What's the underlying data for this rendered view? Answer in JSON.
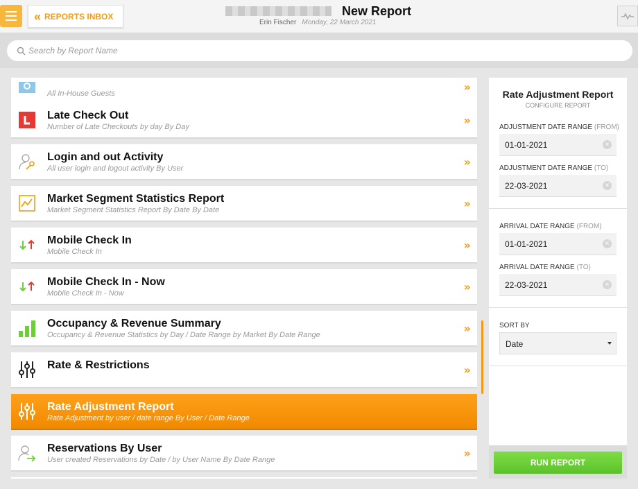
{
  "header": {
    "back_label": "REPORTS INBOX",
    "title": "New Report",
    "user": "Erin Fischer",
    "date": "Monday, 22 March 2021"
  },
  "search": {
    "placeholder": "Search by Report Name"
  },
  "reports": [
    {
      "name": "",
      "desc": "All In-House Guests",
      "icon": "in-house-icon"
    },
    {
      "name": "Late Check Out",
      "desc": "Number of Late Checkouts by day By Day",
      "icon": "late-checkout-icon"
    },
    {
      "name": "Login and out Activity",
      "desc": "All user login and logout activity By User",
      "icon": "user-key-icon"
    },
    {
      "name": "Market Segment Statistics Report",
      "desc": "Market Segment Statistics Report By Date By Date",
      "icon": "line-chart-icon"
    },
    {
      "name": "Mobile Check In",
      "desc": "Mobile Check In",
      "icon": "up-down-arrows-icon"
    },
    {
      "name": "Mobile Check In - Now",
      "desc": "Mobile Check In - Now",
      "icon": "up-down-arrows-icon"
    },
    {
      "name": "Occupancy & Revenue Summary",
      "desc": "Occupancy & Revenue Statistics by Day / Date Range by Market By Date Range",
      "icon": "bar-chart-icon"
    },
    {
      "name": "Rate & Restrictions",
      "desc": "",
      "icon": "sliders-icon"
    },
    {
      "name": "Rate Adjustment Report",
      "desc": "Rate Adjustment by user / date range By User / Date Range",
      "icon": "sliders-icon",
      "active": true
    },
    {
      "name": "Reservations By User",
      "desc": "User created Reservations by Date / by User Name By Date Range",
      "icon": "user-arrow-icon"
    }
  ],
  "panel": {
    "title": "Rate Adjustment Report",
    "subtitle": "CONFIGURE REPORT",
    "adj_from_label": "ADJUSTMENT DATE RANGE",
    "adj_from_hint": "(FROM)",
    "adj_from_value": "01-01-2021",
    "adj_to_label": "ADJUSTMENT DATE RANGE",
    "adj_to_hint": "(TO)",
    "adj_to_value": "22-03-2021",
    "arr_from_label": "ARRIVAL DATE RANGE",
    "arr_from_hint": "(FROM)",
    "arr_from_value": "01-01-2021",
    "arr_to_label": "ARRIVAL DATE RANGE",
    "arr_to_hint": "(TO)",
    "arr_to_value": "22-03-2021",
    "sort_label": "SORT BY",
    "sort_value": "Date",
    "run_label": "RUN REPORT"
  },
  "colors": {
    "accent": "#f39c12",
    "run": "#6ccf35",
    "late_red": "#e53935"
  }
}
